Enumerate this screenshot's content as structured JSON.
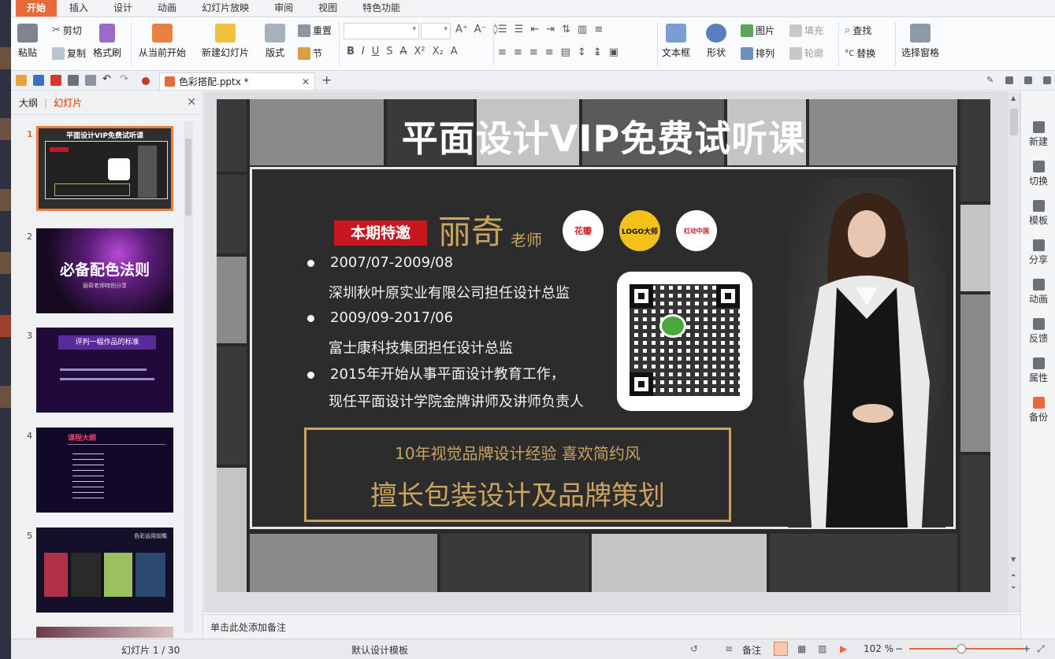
{
  "menu": {
    "tabs": [
      "开始",
      "插入",
      "设计",
      "动画",
      "幻灯片放映",
      "审阅",
      "视图",
      "特色功能"
    ],
    "active_tab": "开始"
  },
  "ribbon": {
    "paste": "粘贴",
    "cut": "剪切",
    "copy": "复制",
    "format_painter": "格式刷",
    "from_current": "从当前开始",
    "new_slide": "新建幻灯片",
    "layout": "版式",
    "reset": "重置",
    "section": "节",
    "textbox": "文本框",
    "shape": "形状",
    "picture": "图片",
    "arrange": "排列",
    "fill": "填充",
    "outline": "轮廓",
    "find": "查找",
    "replace": "替换",
    "selection_pane": "选择窗格"
  },
  "document": {
    "tab_name": "色彩搭配.pptx *"
  },
  "left_panel": {
    "tab_outline": "大纲",
    "tab_slides": "幻灯片",
    "thumbnails": [
      {
        "num": "1",
        "title": "平面设计VIP免费试听课"
      },
      {
        "num": "2",
        "title": "必备配色法则",
        "subtitle": "丽奇老师特别分享"
      },
      {
        "num": "3",
        "title": "评判一幅作品的标准"
      },
      {
        "num": "4",
        "title": "课程大纲"
      },
      {
        "num": "5",
        "title": "色彩运用前瞻"
      }
    ]
  },
  "slide": {
    "title": "平面设计VIP免费试听课",
    "badge": "本期特邀",
    "teacher_name": "丽奇",
    "teacher_title": "老师",
    "logos": [
      "花瓣",
      "LOGO大师",
      "红动中国"
    ],
    "bio": [
      {
        "bullet": true,
        "text": "2007/07-2009/08"
      },
      {
        "bullet": false,
        "text": "深圳秋叶原实业有限公司担任设计总监"
      },
      {
        "bullet": true,
        "text": "2009/09-2017/06"
      },
      {
        "bullet": false,
        "text": "富士康科技集团担任设计总监"
      },
      {
        "bullet": true,
        "text": "2015年开始从事平面设计教育工作，"
      },
      {
        "bullet": false,
        "text": "现任平面设计学院金牌讲师及讲师负责人"
      }
    ],
    "highlight_1": "10年视觉品牌设计经验 喜欢简约风",
    "highlight_2": "擅长包装设计及品牌策划"
  },
  "notes": {
    "placeholder": "单击此处添加备注"
  },
  "right_bar": [
    "新建",
    "切换",
    "模板",
    "分享",
    "动画",
    "反馈",
    "属性",
    "备份"
  ],
  "status": {
    "slide_info": "幻灯片 1 / 30",
    "template": "默认设计模板",
    "notes": "备注",
    "zoom": "102 %"
  },
  "colors": {
    "accent": "#e8693a",
    "gold": "#c9a35f",
    "badge_red": "#c8171e"
  }
}
